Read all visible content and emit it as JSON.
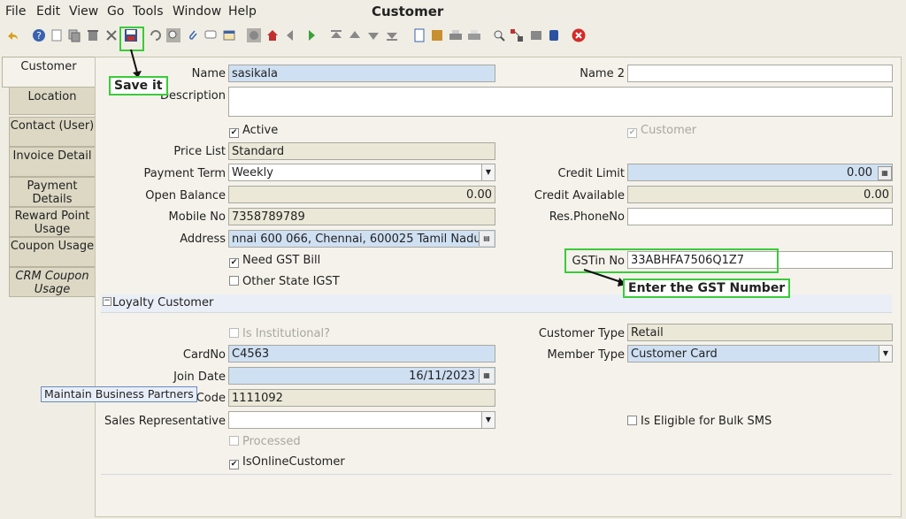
{
  "menu": [
    "File",
    "Edit",
    "View",
    "Go",
    "Tools",
    "Window",
    "Help"
  ],
  "window_title": "Customer",
  "toolbar_icons": [
    "undo-icon",
    "help-icon",
    "new-icon",
    "copy-icon",
    "delete-icon",
    "cut-icon",
    "save-icon",
    "refresh-icon",
    "find-icon",
    "attachment-icon",
    "chat-icon",
    "history-icon",
    "print-preview-icon",
    "home-icon",
    "back-icon",
    "forward-icon",
    "first-record-icon",
    "previous-record-icon",
    "next-record-icon",
    "last-record-icon",
    "report-icon",
    "archive-icon",
    "print-icon",
    "print-alt-icon",
    "zoom-across-icon",
    "workflow-icon",
    "product-info-icon",
    "lock-icon",
    "close-window-icon"
  ],
  "tabs": [
    "Customer",
    "Location",
    "Contact (User)",
    "Invoice Detail",
    "Payment Details",
    "Reward Point Usage",
    "Coupon Usage",
    "CRM Coupon Usage"
  ],
  "form": {
    "name_label": "Name",
    "name_value": "sasikala",
    "name2_label": "Name 2",
    "name2_value": "",
    "description_label": "Description",
    "description_value": "",
    "active_label": "Active",
    "customer_label": "Customer",
    "price_list_label": "Price List",
    "price_list_value": "Standard",
    "payment_term_label": "Payment Term",
    "payment_term_value": "Weekly",
    "credit_limit_label": "Credit Limit",
    "credit_limit_value": "0.00",
    "open_balance_label": "Open Balance",
    "open_balance_value": "0.00",
    "credit_available_label": "Credit Available",
    "credit_available_value": "0.00",
    "mobile_label": "Mobile No",
    "mobile_value": "7358789789",
    "res_phone_label": "Res.PhoneNo",
    "res_phone_value": "",
    "address_label": "Address",
    "address_value": "nnai 600 066, Chennai,  600025 Tamil Nadu",
    "need_gst_label": "Need GST Bill",
    "gstin_label": "GSTin No",
    "gstin_value": "33ABHFA7506Q1Z7",
    "other_state_label": "Other State IGST"
  },
  "loyalty": {
    "section_title": "Loyalty Customer",
    "institutional_label": "Is Institutional?",
    "customer_type_label": "Customer Type",
    "customer_type_value": "Retail",
    "cardno_label": "CardNo",
    "cardno_value": "C4563",
    "member_type_label": "Member Type",
    "member_type_value": "Customer Card",
    "join_date_label": "Join Date",
    "join_date_value": "16/11/2023",
    "code_label": "Code",
    "code_value": "1111092",
    "sales_rep_label": "Sales Representative",
    "sales_rep_value": "",
    "bulk_sms_label": "Is Eligible for Bulk SMS",
    "processed_label": "Processed",
    "online_label": "IsOnlineCustomer"
  },
  "annotations": {
    "save_callout": "Save it",
    "gst_callout": "Enter the GST Number"
  },
  "tooltip": "Maintain Business Partners",
  "colors": {
    "required_field": "#cfe0f3",
    "readonly_field": "#ebe8d8",
    "callout_border": "#3acb3a",
    "close_icon": "#d42a2a"
  }
}
